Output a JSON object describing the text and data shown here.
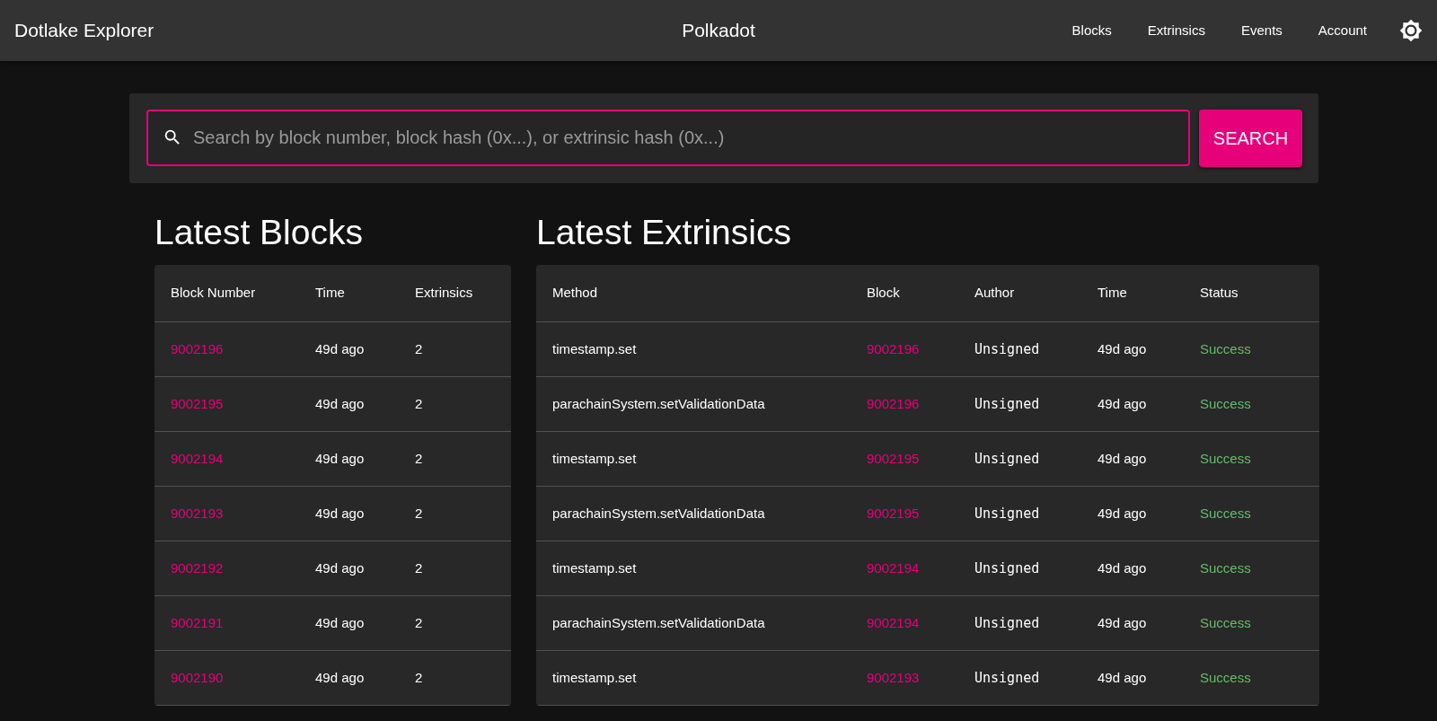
{
  "navbar": {
    "brand": "Dotlake Explorer",
    "network": "Polkadot",
    "links": [
      "Blocks",
      "Extrinsics",
      "Events",
      "Account"
    ]
  },
  "search": {
    "placeholder": "Search by block number, block hash (0x...), or extrinsic hash (0x...)",
    "button": "SEARCH"
  },
  "latest_blocks": {
    "title": "Latest Blocks",
    "columns": [
      "Block Number",
      "Time",
      "Extrinsics"
    ],
    "rows": [
      {
        "block": "9002196",
        "time": "49d ago",
        "extrinsics": "2"
      },
      {
        "block": "9002195",
        "time": "49d ago",
        "extrinsics": "2"
      },
      {
        "block": "9002194",
        "time": "49d ago",
        "extrinsics": "2"
      },
      {
        "block": "9002193",
        "time": "49d ago",
        "extrinsics": "2"
      },
      {
        "block": "9002192",
        "time": "49d ago",
        "extrinsics": "2"
      },
      {
        "block": "9002191",
        "time": "49d ago",
        "extrinsics": "2"
      },
      {
        "block": "9002190",
        "time": "49d ago",
        "extrinsics": "2"
      }
    ]
  },
  "latest_extrinsics": {
    "title": "Latest Extrinsics",
    "columns": [
      "Method",
      "Block",
      "Author",
      "Time",
      "Status"
    ],
    "rows": [
      {
        "method": "timestamp.set",
        "block": "9002196",
        "author": "Unsigned",
        "time": "49d ago",
        "status": "Success",
        "success": true
      },
      {
        "method": "parachainSystem.setValidationData",
        "block": "9002196",
        "author": "Unsigned",
        "time": "49d ago",
        "status": "Success",
        "success": true
      },
      {
        "method": "timestamp.set",
        "block": "9002195",
        "author": "Unsigned",
        "time": "49d ago",
        "status": "Success",
        "success": true
      },
      {
        "method": "parachainSystem.setValidationData",
        "block": "9002195",
        "author": "Unsigned",
        "time": "49d ago",
        "status": "Success",
        "success": true
      },
      {
        "method": "timestamp.set",
        "block": "9002194",
        "author": "Unsigned",
        "time": "49d ago",
        "status": "Success",
        "success": true
      },
      {
        "method": "parachainSystem.setValidationData",
        "block": "9002194",
        "author": "Unsigned",
        "time": "49d ago",
        "status": "Success",
        "success": true
      },
      {
        "method": "timestamp.set",
        "block": "9002193",
        "author": "Unsigned",
        "time": "49d ago",
        "status": "Success",
        "success": true
      }
    ]
  }
}
